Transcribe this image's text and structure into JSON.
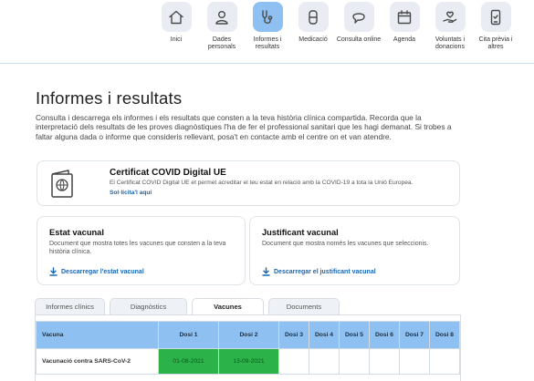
{
  "nav": {
    "items": [
      {
        "label": "Inici",
        "icon": "home-icon"
      },
      {
        "label": "Dades personals",
        "icon": "person-icon"
      },
      {
        "label": "Informes i resultats",
        "icon": "stethoscope-icon",
        "active": true
      },
      {
        "label": "Medicació",
        "icon": "pill-icon"
      },
      {
        "label": "Consulta online",
        "icon": "chat-bubble-icon"
      },
      {
        "label": "Agenda",
        "icon": "calendar-icon"
      },
      {
        "label": "Voluntats i donacions",
        "icon": "heart-hand-icon"
      },
      {
        "label": "Cita prèvia i altres",
        "icon": "phone-icon"
      }
    ]
  },
  "page": {
    "title": "Informes i resultats",
    "intro": "Consulta i descarrega els informes i els resultats que consten a la teva història clínica compartida. Recorda que la interpretació dels resultats de les proves diagnòstiques l'ha de fer el professional sanitari que les hagi demanat. Si trobes a faltar alguna dada o informe que consideris rellevant, posa't en contacte amb el centre on et van atendre."
  },
  "covid_card": {
    "title": "Certificat COVID Digital UE",
    "description": "El Certificat COVID Digital UE et permet acreditar el teu estat en relació amb la COVID-19 a tota la Unió Europea.",
    "link": "Sol·licita'l aquí",
    "icon": "passport-icon"
  },
  "estat_card": {
    "title": "Estat vacunal",
    "description": "Document que mostra totes les vacunes que consten a la teva història clínica.",
    "download": "Descarregar l'estat vacunal"
  },
  "justificant_card": {
    "title": "Justificant vacunal",
    "description": "Document que mostra només les vacunes que seleccionis.",
    "download": "Descarregar el justificant vacunal"
  },
  "tabs": [
    {
      "label": "Informes clínics",
      "active": false
    },
    {
      "label": "Diagnòstics",
      "active": false
    },
    {
      "label": "Vacunes",
      "active": true
    },
    {
      "label": "Documents",
      "active": false
    }
  ],
  "vaccine_table": {
    "headers": [
      "Vacuna",
      "Dosi 1",
      "Dosi 2",
      "Dosi 3",
      "Dosi 4",
      "Dosi 5",
      "Dosi 6",
      "Dosi 7",
      "Dosi 8"
    ],
    "rows": [
      {
        "vacuna": "Vacunació contra SARS-CoV-2",
        "doses": [
          "01-08-2021",
          "13-09-2021",
          "",
          "",
          "",
          "",
          "",
          ""
        ]
      }
    ],
    "done_color": "#2bb34a",
    "header_color": "#8ec0f2"
  },
  "colors": {
    "accent": "#8ec0f2",
    "link": "#1b66b0"
  }
}
